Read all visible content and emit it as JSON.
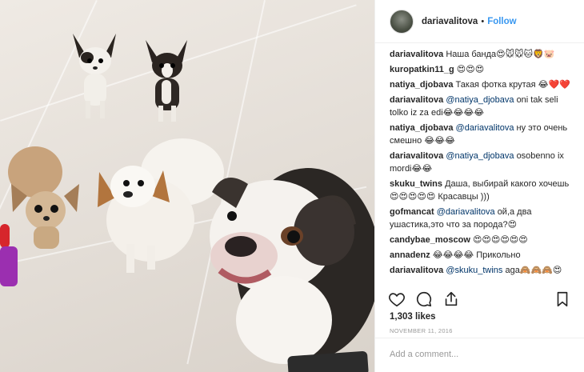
{
  "post": {
    "username": "dariavalitova",
    "follow_label": "Follow",
    "separator": "•"
  },
  "comments": [
    {
      "user": "dariavalitova",
      "text": "Наша банда😍🐭🐭🐱🦁🐷"
    },
    {
      "user": "kuropatkin11_g",
      "text": "😍😍😍"
    },
    {
      "user": "natiya_djobava",
      "text": "Такая фотка крутая 😂❤️❤️"
    },
    {
      "user": "dariavalitova",
      "mention": "@natiya_djobava",
      "text": "oni tak seli tolko iz za edi😂😂😂😂"
    },
    {
      "user": "natiya_djobava",
      "mention": "@dariavalitova",
      "text": "ну это очень смешно 😂😂😂"
    },
    {
      "user": "dariavalitova",
      "mention": "@natiya_djobava",
      "text": "osobenno ix mordi😂😂"
    },
    {
      "user": "skuku_twins",
      "text": "Даша, выбирай какого хочешь 😍😍😍😍😍 Красавцы )))"
    },
    {
      "user": "gofmancat",
      "mention": "@dariavalitova",
      "text": "ой,а два ушастика,это что за порода?😍"
    },
    {
      "user": "candybae_moscow",
      "text": "😍😍😍😍😍😍"
    },
    {
      "user": "annadenz",
      "text": "😂😂😂😂 Прикольно"
    },
    {
      "user": "dariavalitova",
      "mention": "@skuku_twins",
      "text": "aga🙈🙈🙈😍"
    }
  ],
  "actions": {
    "like_icon": "heart-icon",
    "comment_icon": "comment-icon",
    "share_icon": "share-icon",
    "save_icon": "bookmark-icon"
  },
  "likes": "1,303 likes",
  "date": "NOVEMBER 11, 2016",
  "add_comment": {
    "placeholder": "Add a comment..."
  },
  "colors": {
    "link": "#3897f0",
    "mention": "#003569",
    "muted": "#999999",
    "border": "#efefef"
  }
}
